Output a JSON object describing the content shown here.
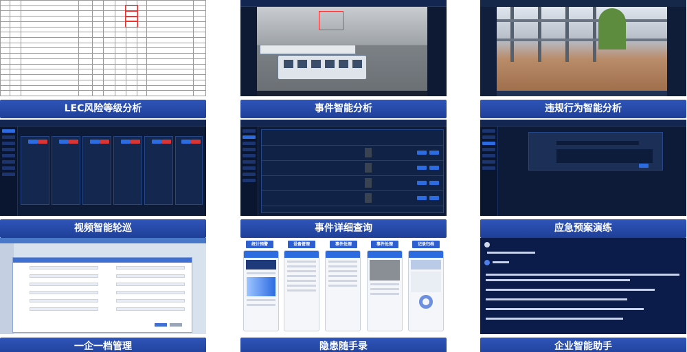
{
  "tiles": {
    "lec": {
      "caption": "LEC风险等级分析"
    },
    "event": {
      "caption": "事件智能分析"
    },
    "violation": {
      "caption": "违规行为智能分析"
    },
    "patrol": {
      "caption": "视频智能轮巡"
    },
    "query": {
      "caption": "事件详细查询"
    },
    "drill": {
      "caption": "应急预案演练"
    },
    "archive": {
      "caption": "一企一档管理"
    },
    "hazard": {
      "caption": "隐患随手录"
    },
    "assistant": {
      "caption": "企业智能助手"
    }
  },
  "phones": {
    "tabs": [
      "统计预警",
      "设备管理",
      "事件处理",
      "事件处理",
      "记录归档"
    ]
  },
  "colors": {
    "caption_bg": "#2647a8",
    "dark_bg": "#0d1b38",
    "accent": "#2d6be0"
  }
}
